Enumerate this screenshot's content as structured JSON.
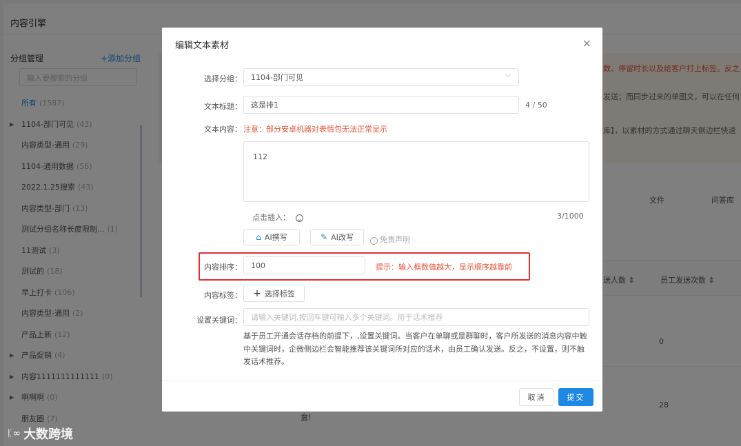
{
  "app": {
    "title": "内容引擎"
  },
  "sidebar": {
    "title": "分组管理",
    "add_label": "+添加分组",
    "search_placeholder": "输入要搜索的分组",
    "items": [
      {
        "label": "所有",
        "count": "(1587)",
        "active": true,
        "expandable": false
      },
      {
        "label": "1104-部门可见",
        "count": "(43)",
        "active": false,
        "expandable": true
      },
      {
        "label": "内容类型-通用",
        "count": "(29)",
        "active": false,
        "expandable": false
      },
      {
        "label": "1104-通用数据",
        "count": "(56)",
        "active": false,
        "expandable": false
      },
      {
        "label": "2022.1.25搜索",
        "count": "(43)",
        "active": false,
        "expandable": false
      },
      {
        "label": "内容类型-部门",
        "count": "(13)",
        "active": false,
        "expandable": false
      },
      {
        "label": "测试分组名称长度限制...",
        "count": "(1)",
        "active": false,
        "expandable": false
      },
      {
        "label": "11测试",
        "count": "(3)",
        "active": false,
        "expandable": false
      },
      {
        "label": "测试的",
        "count": "(18)",
        "active": false,
        "expandable": false
      },
      {
        "label": "早上打卡",
        "count": "(106)",
        "active": false,
        "expandable": false
      },
      {
        "label": "内容类型-通用",
        "count": "(2)",
        "active": false,
        "expandable": false
      },
      {
        "label": "产品上新",
        "count": "(12)",
        "active": false,
        "expandable": false
      },
      {
        "label": "产品促销",
        "count": "(4)",
        "active": false,
        "expandable": true
      },
      {
        "label": "内容1111111111111",
        "count": "(0)",
        "active": false,
        "expandable": true
      },
      {
        "label": "啊啊啊",
        "count": "(0)",
        "active": false,
        "expandable": true
      },
      {
        "label": "朋友圈",
        "count": "(7)",
        "active": false,
        "expandable": false
      }
    ]
  },
  "background": {
    "notice_line1": "数、停留时长以及给客户打上标签。反之",
    "notice_line2": "发送；而同步过来的单图文，可以在任何",
    "notice_line3": "库】，以素材的方式通过聊天侧边栏快速",
    "tab_file": "文件",
    "tab_qa": "问答库",
    "col_recipients": "送人数 ⇕",
    "col_employee_sends": "员工发送次数 ⇕",
    "row1_value": "0",
    "row2_value": "28",
    "row2_text": "盒!"
  },
  "modal": {
    "title": "编辑文本素材",
    "close_glyph": "×",
    "group_label": "选择分组：",
    "group_value": "1104-部门可见",
    "title_label": "文本标题：",
    "title_value": "这是排1",
    "title_counter": "4 / 50",
    "content_label": "文本内容：",
    "content_warning": "注意：部分安卓机器对表情包无法正常显示",
    "content_value": "112",
    "insert_label": "点击插入：",
    "content_counter": "3/1000",
    "ai_write_label": "AI撰写",
    "ai_rewrite_label": "AI改写",
    "disclaimer_label": "免责声明",
    "sort_label": "内容排序：",
    "sort_value": "100",
    "sort_hint": "提示：输入框数值越大，显示顺序越靠前",
    "tags_label": "内容标签：",
    "tags_button": "选择标签",
    "keywords_label": "设置关键词：",
    "keywords_placeholder": "请输入关键词,按回车键可输入多个关键词。用于话术推荐",
    "keywords_description": "基于员工开通会话存档的前提下，,设置关键词。当客户在单聊或是群聊时，客户所发送的消息内容中触中关键词时，企微侧边栏会智能推荐该关键词所对应的话术，由员工确认发送。反之，不设置，则不触发话术推荐。",
    "cancel_label": "取消",
    "submit_label": "提交"
  },
  "watermark": {
    "logo_glyph": "ᛕ∞",
    "text": "大数跨境"
  },
  "colors": {
    "accent": "#1e88e5",
    "warning": "#e6553a",
    "highlight_box": "#e03131"
  }
}
